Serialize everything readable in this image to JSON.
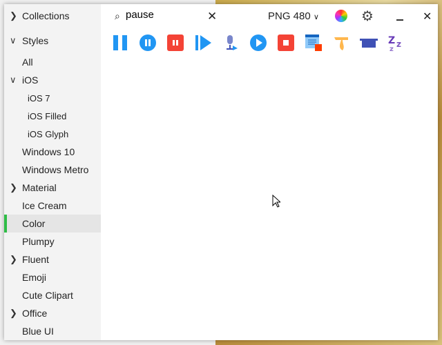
{
  "sidebar": {
    "collections": "Collections",
    "styles": "Styles",
    "items": [
      {
        "label": "All",
        "indent": 0,
        "chevron": ""
      },
      {
        "label": "iOS",
        "indent": 0,
        "chevron": "down"
      },
      {
        "label": "iOS 7",
        "indent": 1,
        "chevron": ""
      },
      {
        "label": "iOS Filled",
        "indent": 1,
        "chevron": ""
      },
      {
        "label": "iOS Glyph",
        "indent": 1,
        "chevron": ""
      },
      {
        "label": "Windows 10",
        "indent": 0,
        "chevron": ""
      },
      {
        "label": "Windows Metro",
        "indent": 0,
        "chevron": ""
      },
      {
        "label": "Material",
        "indent": 0,
        "chevron": "right"
      },
      {
        "label": "Ice Cream",
        "indent": 0,
        "chevron": ""
      },
      {
        "label": "Color",
        "indent": 0,
        "chevron": "",
        "selected": true
      },
      {
        "label": "Plumpy",
        "indent": 0,
        "chevron": ""
      },
      {
        "label": "Fluent",
        "indent": 0,
        "chevron": "right"
      },
      {
        "label": "Emoji",
        "indent": 0,
        "chevron": ""
      },
      {
        "label": "Cute Clipart",
        "indent": 0,
        "chevron": ""
      },
      {
        "label": "Office",
        "indent": 0,
        "chevron": "right"
      },
      {
        "label": "Blue UI",
        "indent": 0,
        "chevron": ""
      }
    ],
    "accent": "#2ebd46"
  },
  "search": {
    "value": "pause"
  },
  "format": "PNG 480",
  "results": [
    "pause",
    "pause-button",
    "pause-squared",
    "resume-button",
    "voice-presentation",
    "circled-play",
    "stop",
    "stop-squared-window",
    "tear-off-calendar",
    "pot",
    "sleep"
  ]
}
